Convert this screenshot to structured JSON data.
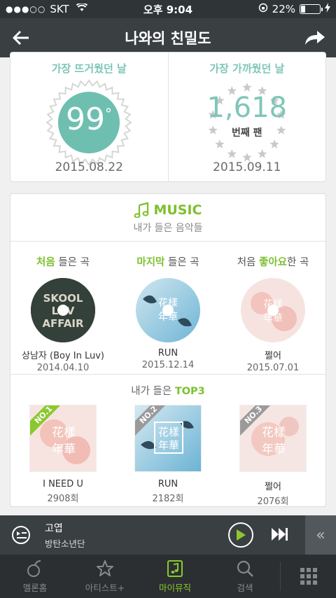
{
  "status": {
    "carrier": "SKT",
    "time": "오후 9:04",
    "battery": "22%",
    "battery_level": 0.22
  },
  "header": {
    "title": "나와의 친밀도",
    "back_icon": "back-arrow-icon",
    "share_icon": "share-icon"
  },
  "hottest": {
    "label": "가장 뜨거웠던 날",
    "value": "99",
    "unit": "°",
    "date": "2015.08.22",
    "color": "#6fbfb0"
  },
  "closest": {
    "label": "가장 가까웠던 날",
    "value": "1,618",
    "unit": "번째 팬",
    "date": "2015.09.11"
  },
  "music": {
    "title": "MUSIC",
    "subtitle": "내가 들은 음악들",
    "firsts": [
      {
        "cap_hl": "처음",
        "cap_rest": " 들은 곡",
        "cap_pre": "",
        "song": "상남자 (Boy In Luv)",
        "date": "2014.04.10"
      },
      {
        "cap_hl": "마지막",
        "cap_rest": " 들은 곡",
        "cap_pre": "",
        "song": "RUN",
        "date": "2015.12.14"
      },
      {
        "cap_pre": "처음 ",
        "cap_hl": "좋아요",
        "cap_rest": "한 곡",
        "song": "쩔어",
        "date": "2015.07.01"
      }
    ],
    "top3_pre": "내가 들은 ",
    "top3_hl": "TOP3",
    "top3": [
      {
        "rank": "NO.1",
        "song": "I NEED U",
        "plays": "2908회",
        "rank_color": "#8bc82f"
      },
      {
        "rank": "NO.2",
        "song": "RUN",
        "plays": "2182회",
        "rank_color": "#9a9a9a"
      },
      {
        "rank": "NO.3",
        "song": "쩔어",
        "plays": "2076회",
        "rank_color": "#9a9a9a"
      }
    ]
  },
  "player": {
    "title": "고엽",
    "artist": "방탄소년단"
  },
  "tabs": [
    {
      "label": "멜론홈",
      "icon": "melon-home-icon"
    },
    {
      "label": "아티스트+",
      "icon": "star-icon"
    },
    {
      "label": "마이뮤직",
      "icon": "my-music-icon",
      "active": true
    },
    {
      "label": "검색",
      "icon": "search-icon"
    }
  ]
}
